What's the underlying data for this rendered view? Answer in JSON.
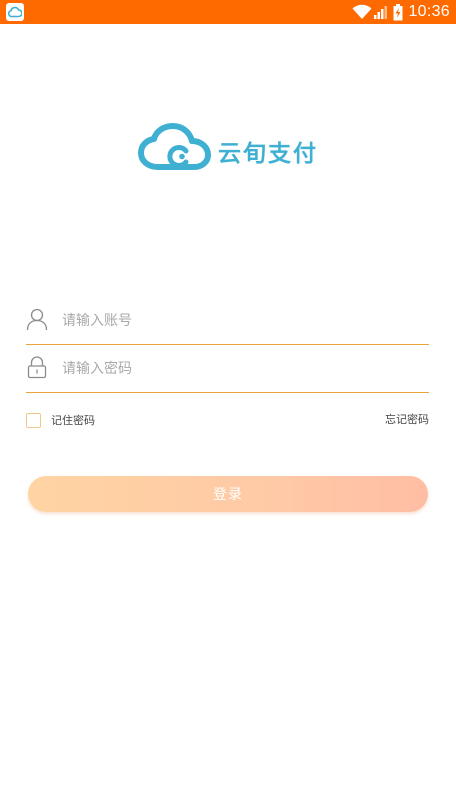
{
  "status_bar": {
    "time": "10:36",
    "icons": [
      "app-notification-icon",
      "wifi-icon",
      "signal-icon",
      "battery-charging-icon"
    ],
    "background": "#ff6a00"
  },
  "logo": {
    "text": "云旬支付",
    "icon": "cloud-logo-icon",
    "color": "#3fb0d2"
  },
  "form": {
    "account": {
      "placeholder": "请输入账号",
      "value": "",
      "icon": "user-icon"
    },
    "password": {
      "placeholder": "请输入密码",
      "value": "",
      "icon": "lock-icon"
    },
    "underline_color": "#e8a33c",
    "remember_label": "记住密码",
    "forgot_label": "忘记密码",
    "login_label": "登录"
  },
  "colors": {
    "button_gradient_start": "#ffd4a3",
    "button_gradient_end": "#ffbea4"
  }
}
